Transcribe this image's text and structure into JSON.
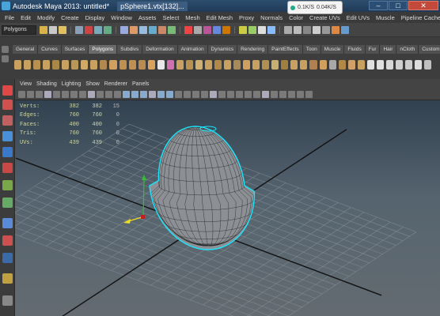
{
  "window": {
    "title": "Autodesk Maya 2013: untitled*",
    "taskbar_tab": "pSphere1.vtx[132]...",
    "net_widget": {
      "down": "0.1K/S",
      "up": "0.04K/S"
    },
    "controls": {
      "minimize": "–",
      "maximize": "□",
      "close": "✕"
    }
  },
  "menubar": [
    "File",
    "Edit",
    "Modify",
    "Create",
    "Display",
    "Window",
    "Assets",
    "Select",
    "Mesh",
    "Edit Mesh",
    "Proxy",
    "Normals",
    "Color",
    "Create UVs",
    "Edit UVs",
    "Muscle",
    "Pipeline Cache",
    "Help"
  ],
  "statusline": {
    "mode": "Polygons"
  },
  "shelf": {
    "tabs": [
      "General",
      "Curves",
      "Surfaces",
      "Polygons",
      "Subdivs",
      "Deformation",
      "Animation",
      "Dynamics",
      "Rendering",
      "PaintEffects",
      "Toon",
      "Muscle",
      "Fluids",
      "Fur",
      "Hair",
      "nCloth",
      "Custom"
    ],
    "active_tab": "Polygons"
  },
  "panel": {
    "menus": [
      "View",
      "Shading",
      "Lighting",
      "Show",
      "Renderer",
      "Panels"
    ]
  },
  "hud": {
    "rows": [
      {
        "label": "Verts:",
        "total": "382",
        "selected": "382",
        "comp": "15"
      },
      {
        "label": "Edges:",
        "total": "760",
        "selected": "760",
        "comp": "0"
      },
      {
        "label": "Faces:",
        "total": "400",
        "selected": "400",
        "comp": "0"
      },
      {
        "label": "Tris:",
        "total": "760",
        "selected": "760",
        "comp": "0"
      },
      {
        "label": "UVs:",
        "total": "439",
        "selected": "439",
        "comp": "0"
      }
    ]
  },
  "colors": {
    "wireframe": "#19e6ff",
    "mesh": "#8c9095",
    "grid": "#8e969c",
    "axis": "#111111"
  }
}
